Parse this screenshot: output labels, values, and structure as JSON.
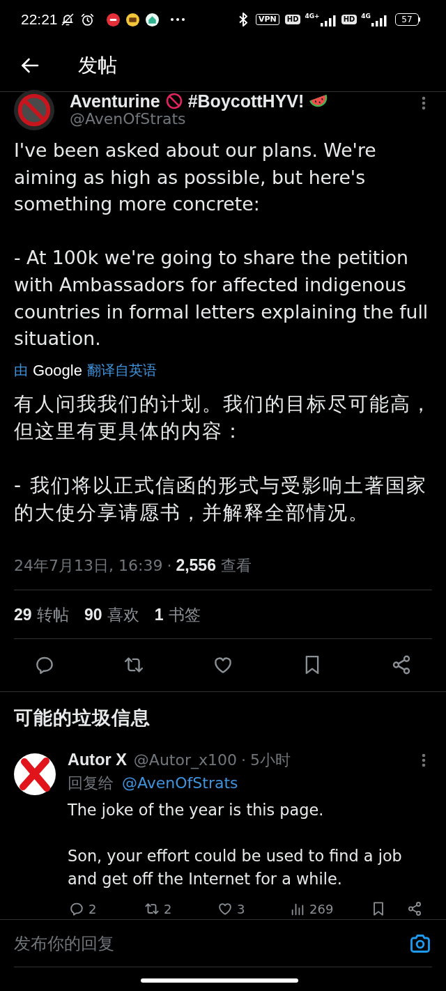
{
  "status_bar": {
    "time": "22:21",
    "vpn": "VPN",
    "networks": [
      {
        "hd": "HD",
        "type": "4G+"
      },
      {
        "hd": "HD",
        "type": "4G"
      }
    ],
    "battery": "57"
  },
  "header": {
    "title": "发帖"
  },
  "post": {
    "author": {
      "name": "Aventurine",
      "name_suffix": "#BoycottHYV!",
      "handle": "@AvenOfStrats"
    },
    "paragraphs": [
      "I've been asked about our plans. We're aiming as high as possible, but here's something more concrete:",
      "- At 100k we're going to share the petition with Ambassadors for affected indigenous countries in formal letters explaining the full situation."
    ],
    "translation": {
      "prefix": "由",
      "provider": "Google",
      "label": "翻译自英语"
    },
    "translated_paragraphs": [
      "有人问我我们的计划。我们的目标尽可能高，但这里有更具体的内容：",
      "- 我们将以正式信函的形式与受影响土著国家的大使分享请愿书，并解释全部情况。"
    ],
    "timestamp": "24年7月13日, 16:39",
    "separator": "·",
    "views": "2,556",
    "views_label": "查看",
    "stats": [
      "**29** 转帖",
      "**90** 喜欢",
      "**1** 书签"
    ],
    "actions": [
      {
        "kind": "reply"
      },
      {
        "kind": "repost"
      },
      {
        "kind": "like"
      },
      {
        "kind": "bookmark"
      },
      {
        "kind": "share"
      }
    ]
  },
  "section": {
    "title": "可能的垃圾信息"
  },
  "replies": [
    {
      "name": "Autor X",
      "handle": "@Autor_x100",
      "separator": "·",
      "time": "5小时",
      "reply_to_label": "回复给",
      "reply_to": "@AvenOfStrats",
      "paragraphs": [
        "The joke of the year is this page.",
        "Son, your effort could be used to find a job and get off the Internet for a while."
      ],
      "actions": [
        {
          "kind": "reply",
          "count": "2"
        },
        {
          "kind": "repost",
          "count": "2"
        },
        {
          "kind": "like",
          "count": "3"
        },
        {
          "kind": "views",
          "count": "269"
        },
        {
          "kind": "bookmark"
        },
        {
          "kind": "share"
        }
      ]
    }
  ],
  "composer": {
    "placeholder": "发布你的回复"
  }
}
